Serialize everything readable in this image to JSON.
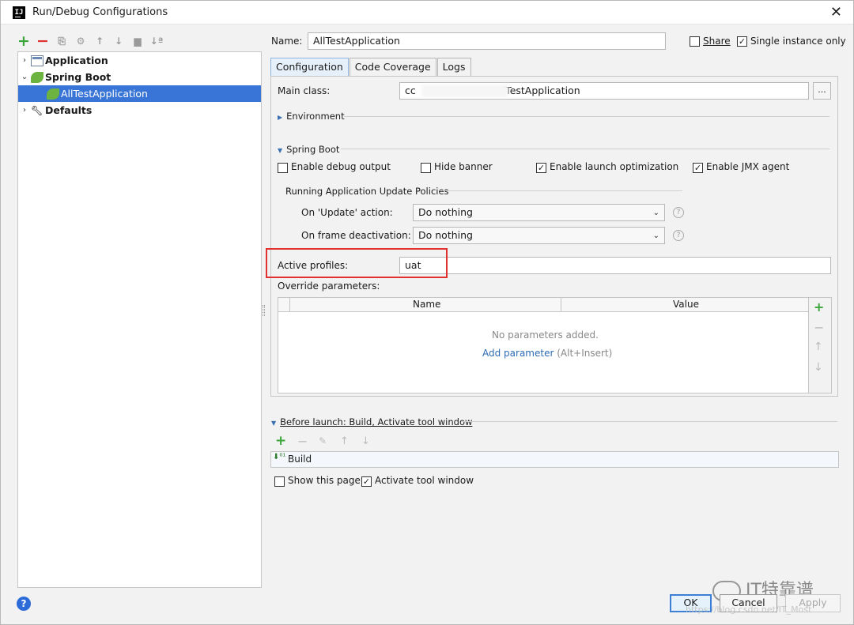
{
  "window": {
    "title": "Run/Debug Configurations",
    "app_icon_text": "IJ"
  },
  "toolbar": {
    "add": "+",
    "remove": "−",
    "copy": "⎘",
    "settings": "⚙",
    "up": "↑",
    "down": "↓",
    "folder": "▆",
    "sort": "↓ª"
  },
  "tree": {
    "items": [
      {
        "label": "Application",
        "arrow": "›",
        "icon": "application-icon"
      },
      {
        "label": "Spring Boot",
        "arrow": "⌄",
        "icon": "spring-boot-icon"
      },
      {
        "label": "AllTestApplication",
        "arrow": "",
        "icon": "spring-boot-icon",
        "selected": true
      },
      {
        "label": "Defaults",
        "arrow": "›",
        "icon": "wrench-icon"
      }
    ]
  },
  "header": {
    "name_label": "Name:",
    "name_value": "AllTestApplication",
    "share_label": "Share",
    "share_checked": false,
    "single_instance_label": "Single instance only",
    "single_instance_checked": true
  },
  "tabs": [
    {
      "label": "Configuration",
      "active": true
    },
    {
      "label": "Code Coverage",
      "active": false
    },
    {
      "label": "Logs",
      "active": false
    }
  ],
  "config": {
    "main_class_label": "Main class:",
    "main_class_prefix": "cc",
    "main_class_suffix": "lTestApplication",
    "browse_button": "...",
    "environment_label": "Environment",
    "spring_boot_label": "Spring Boot",
    "enable_debug_label": "Enable debug output",
    "enable_debug_checked": false,
    "hide_banner_label": "Hide banner",
    "hide_banner_checked": false,
    "launch_opt_label": "Enable launch optimization",
    "launch_opt_checked": true,
    "jmx_label": "Enable JMX agent",
    "jmx_checked": true,
    "policies_label": "Running Application Update Policies",
    "on_update_label": "On 'Update' action:",
    "on_update_value": "Do nothing",
    "on_frame_label": "On frame deactivation:",
    "on_frame_value": "Do nothing",
    "active_profiles_label": "Active profiles:",
    "active_profiles_value": "uat",
    "override_label": "Override parameters:",
    "col_name": "Name",
    "col_value": "Value",
    "empty_text": "No parameters added.",
    "add_param_link": "Add parameter",
    "add_param_shortcut": "(Alt+Insert)"
  },
  "before_launch": {
    "label": "Before launch: Build, Activate tool window",
    "build_item": "Build",
    "show_page_label": "Show this page",
    "show_page_checked": false,
    "activate_label": "Activate tool window",
    "activate_checked": true
  },
  "buttons": {
    "ok": "OK",
    "cancel": "Cancel",
    "apply": "Apply"
  },
  "watermark": {
    "text": "IT特靠谱",
    "url": "https://blog.csdn.net/IT_Most"
  },
  "colors": {
    "selection": "#3875d7",
    "highlight_box": "#e23030",
    "link": "#2d6bb5"
  }
}
